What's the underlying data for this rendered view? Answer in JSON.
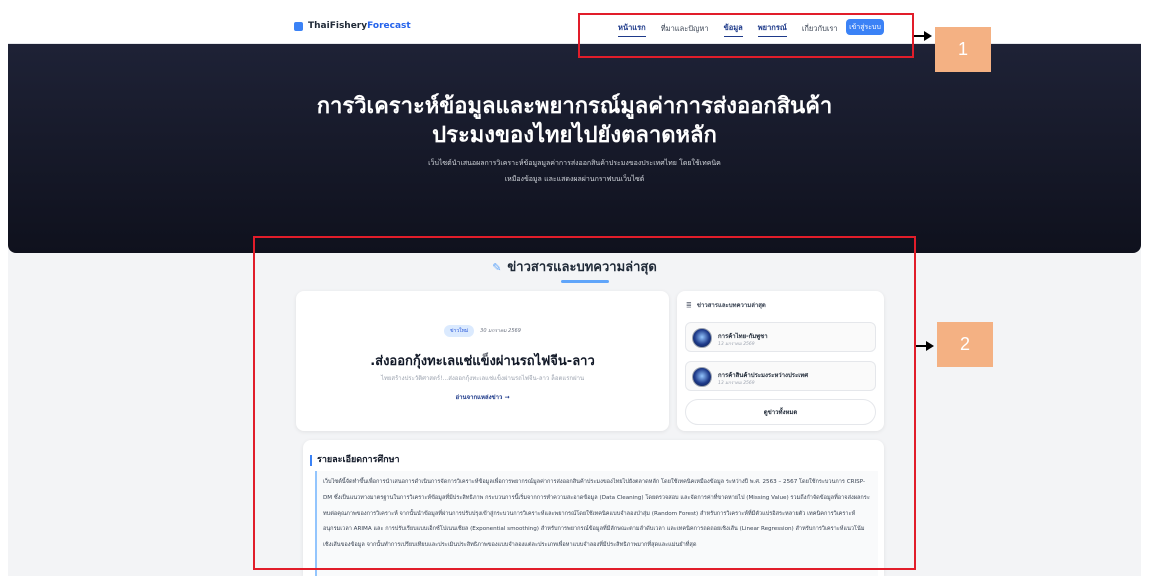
{
  "nav": {
    "brand_first": "ThaiFishery",
    "brand_second": "Forecast",
    "items": [
      {
        "label": "หน้าแรก",
        "active": true
      },
      {
        "label": "ที่มาและปัญหา",
        "active": false
      },
      {
        "label": "ข้อมูล",
        "active": true
      },
      {
        "label": "พยากรณ์",
        "active": true
      },
      {
        "label": "เกี่ยวกับเรา",
        "active": false
      }
    ],
    "login_label": "เข้าสู่ระบบ"
  },
  "hero": {
    "title_line1": "การวิเคราะห์ข้อมูลและพยากรณ์มูลค่าการส่งออกสินค้า",
    "title_line2": "ประมงของไทยไปยังตลาดหลัก",
    "subtitle_line1": "เว็บไซต์นำเสนอผลการวิเคราะห์ข้อมูลมูลค่าการส่งออกสินค้าประมงของประเทศไทย โดยใช้เทคนิค",
    "subtitle_line2": "เหมืองข้อมูล และแสดงผลผ่านกราฟบนเว็บไซต์"
  },
  "news": {
    "heading": "ข่าวสารและบทความล่าสุด",
    "feature": {
      "badge": "ข่าวใหม่",
      "date": "30 มกราคม 2569",
      "title": ".ส่งออกกุ้งทะเลแช่แข็งผ่านรถไฟจีน-ลาว",
      "desc": "ไทยสร้างประวัติศาสตร์!...ส่งออกกุ้งทะเลแช่แข็งผ่านรถไฟจีน-ลาว ล็อตแรกผ่าน",
      "link": "อ่านจากแหล่งข่าว →"
    },
    "side": {
      "heading": "ข่าวสารและบทความล่าสุด",
      "items": [
        {
          "title": "การค้าไทย-กัมพูชา",
          "date": "13 มกราคม 2569"
        },
        {
          "title": "การค้าสินค้าประมงระหว่างประเทศ",
          "date": "13 มกราคม 2569"
        }
      ],
      "more_label": "ดูข่าวทั้งหมด"
    }
  },
  "details": {
    "title": "รายละเอียดการศึกษา",
    "body": "เว็บไซต์นี้จัดทำขึ้นเพื่อการนำเสนอการดำเนินการจัดการวิเคราะห์ข้อมูลเพื่อการพยากรณ์มูลค่าการส่งออกสินค้าประมงของไทยไปยังตลาดหลัก โดยใช้เทคนิคเหมืองข้อมูล ระหว่างปี พ.ศ. 2563 – 2567 โดยใช้กระบวนการ CRISP-DM ซึ่งเป็นแนวทางมาตรฐานในการวิเคราะห์ข้อมูลที่มีประสิทธิภาพ กระบวนการนี้เริ่มจากการทำความสะอาดข้อมูล (Data Cleaning) โดยตรวจสอบ และจัดการค่าที่ขาดหายไป (Missing Value) รวมถึงกำจัดข้อมูลที่อาจส่งผลกระทบต่อคุณภาพของการวิเคราะห์ จากนั้นนำข้อมูลที่ผ่านการปรับปรุงเข้าสู่กระบวนการวิเคราะห์และพยากรณ์โดยใช้เทคนิคแบบจำลองป่าสุ่ม (Random Forest) สำหรับการวิเคราะห์ที่มีตัวแปรอิสระหลายตัว เทคนิคการวิเคราะห์อนุกรมเวลา ARIMA และ การปรับเรียบแบบเอ็กซ์โปเนนเชียล (Exponential smoothing) สำหรับการพยากรณ์ข้อมูลที่มีลักษณะตามลำดับเวลา และเทคนิคการถดถอยเชิงเส้น (Linear Regression) สำหรับการวิเคราะห์แนวโน้มเชิงเส้นของข้อมูล จากนั้นทำการเปรียบเทียบและประเมินประสิทธิภาพของแบบจำลองแต่ละประเภทเพื่อหาแบบจำลองที่มีประสิทธิภาพมากที่สุดและแม่นยำที่สุด"
  },
  "annotations": {
    "label_1": "1",
    "label_2": "2",
    "box_color": "#e11d2a",
    "label_color": "#f4b183"
  }
}
